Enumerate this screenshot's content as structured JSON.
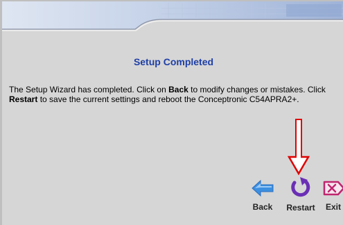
{
  "page": {
    "title": "Setup Completed",
    "message": {
      "part1": "The Setup Wizard has completed. Click on ",
      "back_word": "Back",
      "part2": " to modify changes or mistakes. Click ",
      "restart_word": "Restart",
      "part3": " to save the current settings and reboot the Conceptronic C54APRA2+."
    }
  },
  "buttons": {
    "back": {
      "label": "Back",
      "icon": "left-arrow-icon"
    },
    "restart": {
      "label": "Restart",
      "icon": "restart-icon"
    },
    "exit": {
      "label": "Exit",
      "icon": "exit-icon"
    }
  },
  "colors": {
    "title": "#1e3fa6",
    "panel_background": "#d6d6d6",
    "pointer_arrow": "#e00000",
    "back_icon": "#3d8fe0",
    "restart_icon": "#6a2fb5",
    "exit_icon": "#c0256e"
  }
}
